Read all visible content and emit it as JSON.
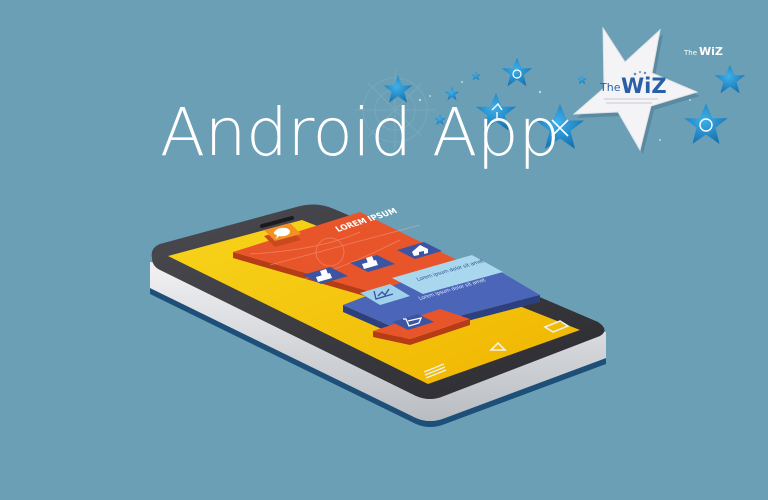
{
  "title": "Android App",
  "logo": {
    "the": "The",
    "wiz": "WiZ",
    "small_the": "The",
    "small_wiz": "WiZ"
  },
  "screen": {
    "banner": "LOREM IPSUM",
    "caption": "Lorem ipsum dolor sit amet",
    "text": "Lorem ipsum dolor sit amet"
  },
  "icons": [
    "chat-bubble-icon",
    "user-icon",
    "user-card-icon",
    "home-icon",
    "chart-icon",
    "shopping-cart-icon",
    "compass-icon",
    "star-icon"
  ],
  "colors": {
    "background": "#6b9fb5",
    "phone_body": "#3a3a3e",
    "screen_yellow": "#f2c200",
    "panel_orange": "#e8552a",
    "panel_blue": "#3b55a3",
    "star_blue": "#1e88c8",
    "logo_blue": "#2a5fa8",
    "logo_star": "#f4f4f6"
  }
}
